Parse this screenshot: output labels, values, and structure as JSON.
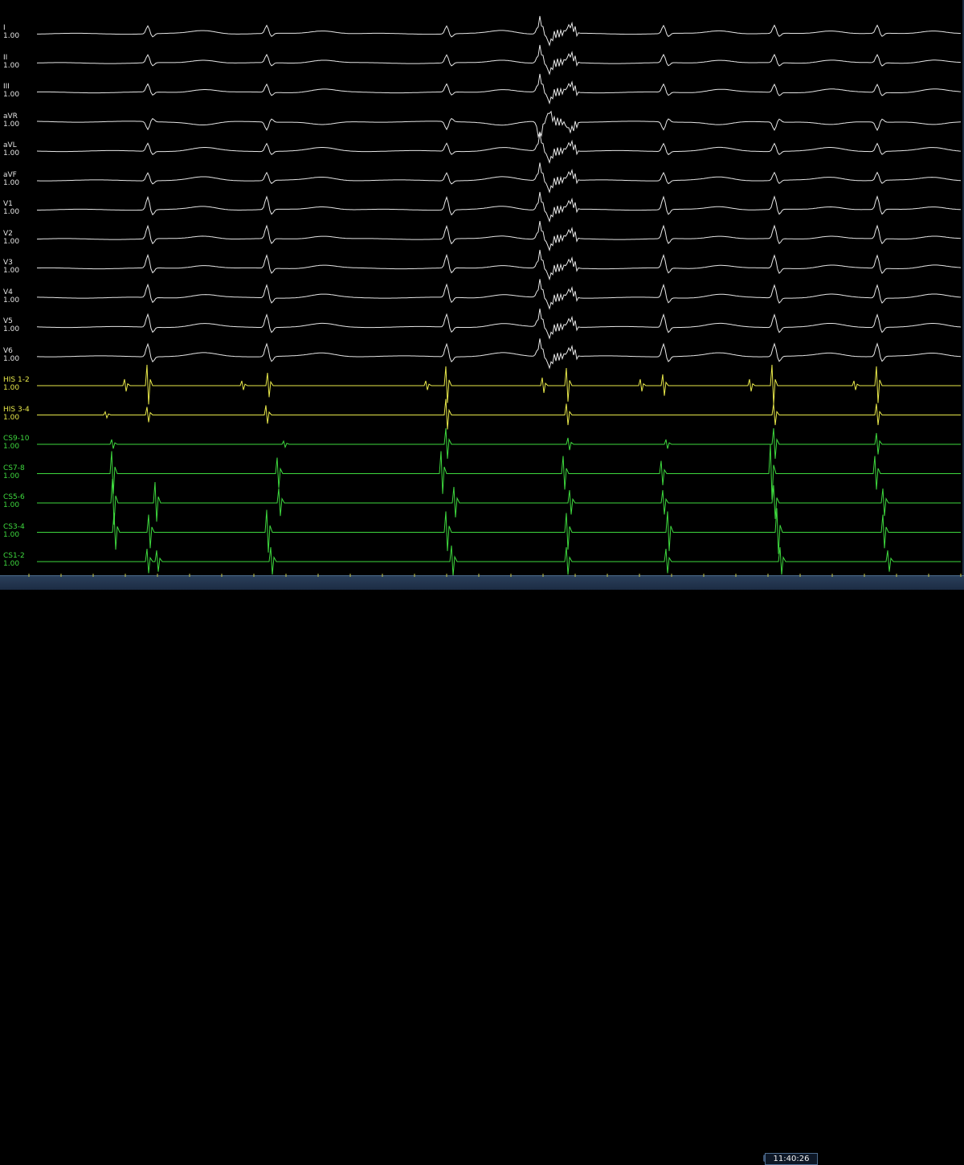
{
  "channels": [
    {
      "name": "I",
      "gain": "1.00",
      "group": "white"
    },
    {
      "name": "II",
      "gain": "1.00",
      "group": "white"
    },
    {
      "name": "III",
      "gain": "1.00",
      "group": "white"
    },
    {
      "name": "aVR",
      "gain": "1.00",
      "group": "white"
    },
    {
      "name": "aVL",
      "gain": "1.00",
      "group": "white"
    },
    {
      "name": "aVF",
      "gain": "1.00",
      "group": "white"
    },
    {
      "name": "V1",
      "gain": "1.00",
      "group": "white"
    },
    {
      "name": "V2",
      "gain": "1.00",
      "group": "white"
    },
    {
      "name": "V3",
      "gain": "1.00",
      "group": "white"
    },
    {
      "name": "V4",
      "gain": "1.00",
      "group": "white"
    },
    {
      "name": "V5",
      "gain": "1.00",
      "group": "white"
    },
    {
      "name": "V6",
      "gain": "1.00",
      "group": "white"
    },
    {
      "name": "HIS 1-2",
      "gain": "1.00",
      "group": "yellow"
    },
    {
      "name": "HIS 3-4",
      "gain": "1.00",
      "group": "yellow"
    },
    {
      "name": "CS9-10",
      "gain": "1.00",
      "group": "green"
    },
    {
      "name": "CS7-8",
      "gain": "1.00",
      "group": "green"
    },
    {
      "name": "CS5-6",
      "gain": "1.00",
      "group": "green"
    },
    {
      "name": "CS3-4",
      "gain": "1.00",
      "group": "green"
    },
    {
      "name": "CS1-2",
      "gain": "1.00",
      "group": "green"
    }
  ],
  "timestamp": "11:40:26",
  "colors": {
    "background": "#000000",
    "surface_ecg": "#e6e6e6",
    "his": "#e8e84a",
    "cs": "#3ed83e",
    "time_bar": "#1c2c44"
  }
}
